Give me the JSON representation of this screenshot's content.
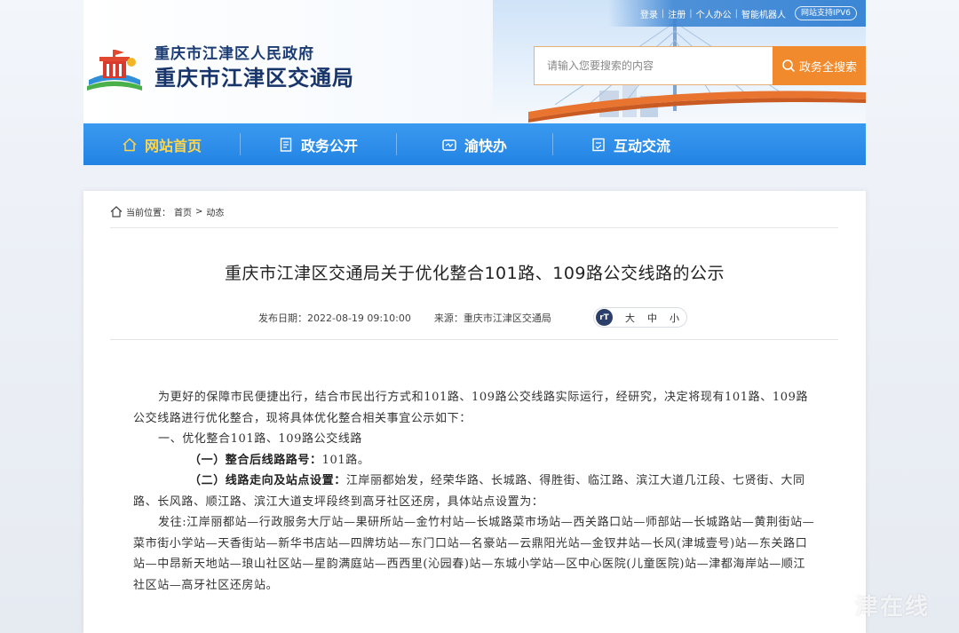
{
  "topbar": {
    "links": [
      "登录",
      "注册",
      "个人办公",
      "智能机器人"
    ],
    "ipv6": "网站支持IPV6"
  },
  "header": {
    "gov_name": "重庆市江津区人民政府",
    "dept_name": "重庆市江津区交通局",
    "search_placeholder": "请输入您要搜索的内容",
    "search_button": "政务全搜索"
  },
  "nav": {
    "items": [
      {
        "label": "网站首页",
        "icon": "home-icon"
      },
      {
        "label": "政务公开",
        "icon": "document-icon"
      },
      {
        "label": "渝快办",
        "icon": "service-icon"
      },
      {
        "label": "互动交流",
        "icon": "interaction-icon"
      }
    ]
  },
  "breadcrumb": {
    "prefix": "当前位置：",
    "home": "首页",
    "separator": ">",
    "current": "动态"
  },
  "article": {
    "title": "重庆市江津区交通局关于优化整合101路、109路公交线路的公示",
    "date_label": "发布日期：",
    "date": "2022-08-19 09:10:00",
    "source_label": "来源：",
    "source": "重庆市江津区交通局",
    "font_sizes": [
      "大",
      "中",
      "小"
    ],
    "paragraph_1": "为更好的保障市民便捷出行，结合市民出行方式和101路、109路公交线路实际运行，经研究，决定将现有101路、109路公交线路进行优化整合，现将具体优化整合相关事宜公示如下：",
    "section_1": "一、优化整合101路、109路公交线路",
    "item_1_label": "（一）整合后线路路号：",
    "item_1_text": "101路。",
    "item_2_label": "（二）线路走向及站点设置：",
    "item_2_text": "江岸丽都始发，经荣华路、长城路、得胜街、临江路、滨江大道几江段、七贤街、大同路、长风路、顺江路、滨江大道支坪段终到高牙社区还房，具体站点设置为：",
    "stops_text": "发往:江岸丽都站—行政服务大厅站—果研所站—金竹村站—长城路菜市场站—西关路口站—师部站—长城路站—黄荆街站—菜市街小学站—天香街站—新华书店站—四牌坊站—东门口站—名豪站—云鼎阳光站—金钗井站—长风(津城壹号)站—东关路口站—中昂新天地站—琅山社区站—星韵满庭站—西西里(沁园春)站—东城小学站—区中心医院(儿童医院)站—津都海岸站—顺江社区站—高牙社区还房站。"
  },
  "watermark": "津在线",
  "colors": {
    "nav_blue": "#2383e3",
    "nav_active": "#ffd54a",
    "search_orange": "#f08a2c",
    "title_navy": "#17356b"
  }
}
